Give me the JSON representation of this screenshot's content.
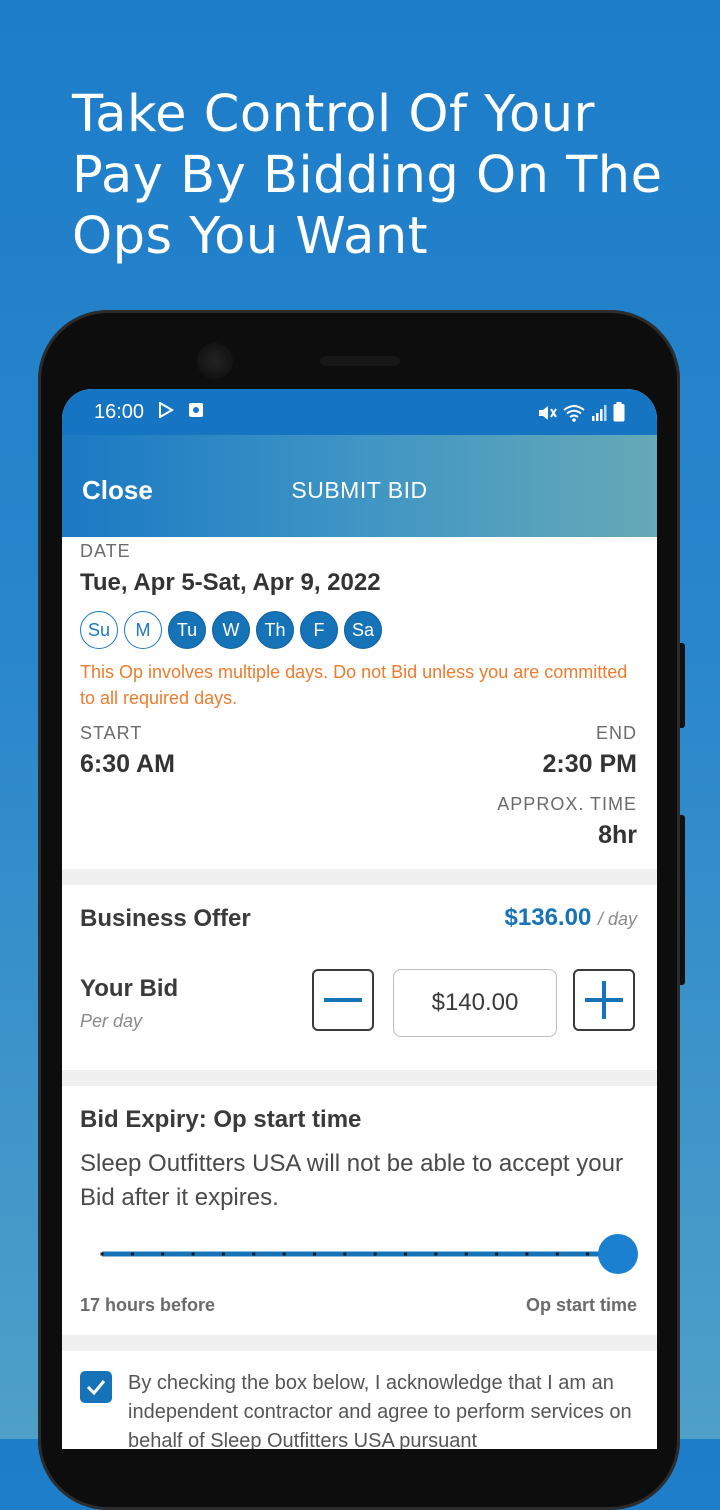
{
  "headline": {
    "line1": "Take Control Of Your",
    "line2": "Pay By Bidding On The",
    "line3": "Ops You Want"
  },
  "status_bar": {
    "time": "16:00",
    "left_icons": [
      "play-store-icon",
      "notification-box-icon"
    ],
    "right_icons": [
      "mute-icon",
      "wifi-icon",
      "signal-icon",
      "battery-icon"
    ]
  },
  "app_bar": {
    "close_label": "Close",
    "title": "SUBMIT BID"
  },
  "date_section": {
    "label": "DATE",
    "value": "Tue, Apr 5-Sat, Apr 9, 2022",
    "days": [
      {
        "label": "Su",
        "selected": false
      },
      {
        "label": "M",
        "selected": false
      },
      {
        "label": "Tu",
        "selected": true
      },
      {
        "label": "W",
        "selected": true
      },
      {
        "label": "Th",
        "selected": true
      },
      {
        "label": "F",
        "selected": true
      },
      {
        "label": "Sa",
        "selected": true
      }
    ],
    "warning": "This Op involves multiple days. Do not Bid unless you are committed to all required days.",
    "start_label": "START",
    "start_value": "6:30 AM",
    "end_label": "END",
    "end_value": "2:30 PM",
    "approx_label": "APPROX. TIME",
    "approx_value": "8hr"
  },
  "offer_section": {
    "business_offer_label": "Business Offer",
    "business_offer_value": "$136.00",
    "business_offer_unit": "/ day",
    "your_bid_label": "Your Bid",
    "your_bid_sub": "Per day",
    "your_bid_value": "$140.00"
  },
  "expiry_section": {
    "title": "Bid Expiry:  Op start time",
    "description": "Sleep Outfitters USA will not be able to accept your Bid after it expires.",
    "slider_min_label": "17 hours before",
    "slider_max_label": "Op start time",
    "slider_position": 1.0,
    "slider_ticks": 18
  },
  "ack_section": {
    "checked": true,
    "text": "By checking the box below, I acknowledge that I am an independent contractor and agree to perform services on behalf of Sleep Outfitters USA pursuant"
  },
  "colors": {
    "primary": "#1673b8",
    "warning": "#f07b2d",
    "background_blue": "#1d7dc9"
  }
}
